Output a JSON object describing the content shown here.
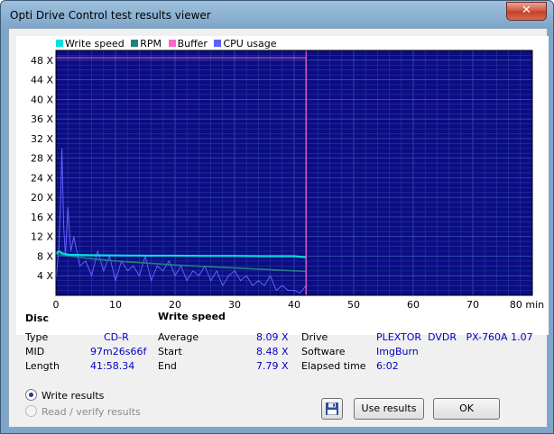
{
  "window": {
    "title": "Opti Drive Control test results viewer",
    "close_label": "✕"
  },
  "legend": [
    {
      "label": "Write speed",
      "color": "#00e0e0"
    },
    {
      "label": "RPM",
      "color": "#208080"
    },
    {
      "label": "Buffer",
      "color": "#ff66cc"
    },
    {
      "label": "CPU usage",
      "color": "#6060ff"
    }
  ],
  "chart_data": {
    "type": "line",
    "x_ticks": [
      "0",
      "10",
      "20",
      "30",
      "40",
      "50",
      "60",
      "70",
      "80 min"
    ],
    "y_ticks": [
      "4 X",
      "8 X",
      "12 X",
      "16 X",
      "20 X",
      "24 X",
      "28 X",
      "32 X",
      "36 X",
      "40 X",
      "44 X",
      "48 X"
    ],
    "xlim": [
      0,
      80
    ],
    "ylim": [
      0,
      50
    ],
    "grid": true,
    "legend_position": "top-left",
    "end_marker_x": 42,
    "series": [
      {
        "name": "Write speed",
        "color": "#00e0e0",
        "x": [
          0,
          0.5,
          1,
          2,
          5,
          10,
          15,
          20,
          25,
          30,
          35,
          40,
          41.97
        ],
        "y": [
          8.48,
          9.0,
          8.6,
          8.3,
          8.2,
          8.15,
          8.1,
          8.1,
          8.05,
          8.05,
          8.0,
          8.0,
          7.79
        ]
      },
      {
        "name": "RPM",
        "color": "#208080",
        "x": [
          0,
          1,
          5,
          10,
          15,
          20,
          25,
          30,
          35,
          40,
          41.97
        ],
        "y": [
          8.5,
          8.2,
          7.6,
          7.0,
          6.6,
          6.2,
          5.9,
          5.6,
          5.3,
          5.0,
          4.9
        ]
      },
      {
        "name": "Buffer",
        "color": "#ff66cc",
        "x": [
          0,
          41.9,
          42,
          42,
          80
        ],
        "y": [
          48.5,
          48.5,
          48.5,
          0,
          0
        ]
      },
      {
        "name": "CPU usage",
        "color": "#6060ff",
        "x": [
          0,
          0.5,
          0.8,
          1,
          1.3,
          1.6,
          2,
          2.5,
          3,
          4,
          5,
          6,
          7,
          8,
          9,
          10,
          11,
          12,
          13,
          14,
          15,
          16,
          17,
          18,
          19,
          20,
          21,
          22,
          23,
          24,
          25,
          26,
          27,
          28,
          29,
          30,
          31,
          32,
          33,
          34,
          35,
          36,
          37,
          38,
          39,
          40,
          41,
          42
        ],
        "y": [
          3,
          10,
          20,
          30,
          14,
          8,
          18,
          9,
          12,
          6,
          7,
          4,
          9,
          5,
          8,
          3,
          7,
          5,
          6,
          4,
          8,
          3,
          6,
          5,
          7,
          4,
          6,
          3,
          5,
          4,
          6,
          3,
          5,
          2,
          4,
          5,
          3,
          4,
          2,
          3,
          2,
          4,
          1,
          2,
          1,
          1,
          0.5,
          2
        ]
      }
    ]
  },
  "disc": {
    "heading": "Disc",
    "rows": [
      {
        "label": "Type",
        "value": "CD-R"
      },
      {
        "label": "MID",
        "value": "97m26s66f"
      },
      {
        "label": "Length",
        "value": "41:58.34"
      }
    ]
  },
  "write_speed": {
    "heading": "Write speed",
    "rows": [
      {
        "label": "Average",
        "value": "8.09 X"
      },
      {
        "label": "Start",
        "value": "8.48 X"
      },
      {
        "label": "End",
        "value": "7.79 X"
      }
    ]
  },
  "drive_info": {
    "rows": [
      {
        "label": "Drive",
        "value": "PLEXTOR  DVDR   PX-760A 1.07"
      },
      {
        "label": "Software",
        "value": "ImgBurn"
      },
      {
        "label": "Elapsed time",
        "value": "6:02"
      }
    ]
  },
  "options": {
    "write_results": "Write results",
    "read_verify_results": "Read / verify results"
  },
  "buttons": {
    "use_results": "Use results",
    "ok": "OK"
  }
}
